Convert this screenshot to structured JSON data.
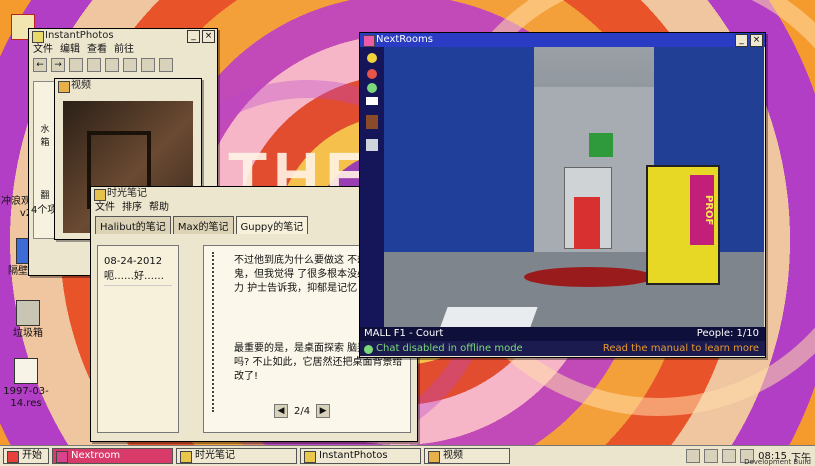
{
  "desktop": {
    "icons": [
      {
        "label": "",
        "name": "desktop-icon-warning"
      },
      {
        "label": "冲浪观察器v2",
        "name": "desktop-icon-browser"
      },
      {
        "label": "隔壁房间",
        "name": "desktop-icon-nextroom"
      },
      {
        "label": "垃圾箱",
        "name": "desktop-icon-trash"
      },
      {
        "label": "1997-03-14.res",
        "name": "desktop-icon-file"
      }
    ],
    "background_text": "THE"
  },
  "instantphotos": {
    "title": "InstantPhotos",
    "menu": [
      "文件",
      "编辑",
      "查看",
      "前往"
    ],
    "status": "4个项",
    "side_items": [
      "水",
      "箱",
      "翻"
    ]
  },
  "video": {
    "title": "视频"
  },
  "notes": {
    "title": "时光笔记",
    "menu": [
      "文件",
      "排序",
      "帮助"
    ],
    "tabs": [
      "Halibut的笔记",
      "Max的笔记",
      "Guppy的笔记"
    ],
    "date": "08-24-2012",
    "entry_preview": "呃……好……",
    "body_1": "不过他到底为什么要做这 不想疑神疑鬼，但我觉得 了很多根本没必要的压力 护士告诉我，抑郁是记忆 敌人。",
    "body_2": "最重要的是，是桌面探索 脑弄崩溃了吗? 不止如此，它居然还把桌面背景给改了!",
    "page": "2/4"
  },
  "nextrooms": {
    "title": "NextRooms",
    "location": "MALL F1 - Court",
    "people": "People: 1/10",
    "chat": "Chat disabled in offline mode",
    "manual": "Read the manual to learn more",
    "sign": "PROF"
  },
  "taskbar": {
    "start": "开始",
    "tasks": [
      "Nextroom",
      "时光笔记",
      "InstantPhotos",
      "视频"
    ],
    "time": "08:15",
    "ampm": "下午",
    "build": "Development Build"
  },
  "colors": {
    "accent": "#2a3cc4",
    "active_task": "#d83a69",
    "chat_green": "#7bd87b",
    "manual_orange": "#e89a2e"
  }
}
